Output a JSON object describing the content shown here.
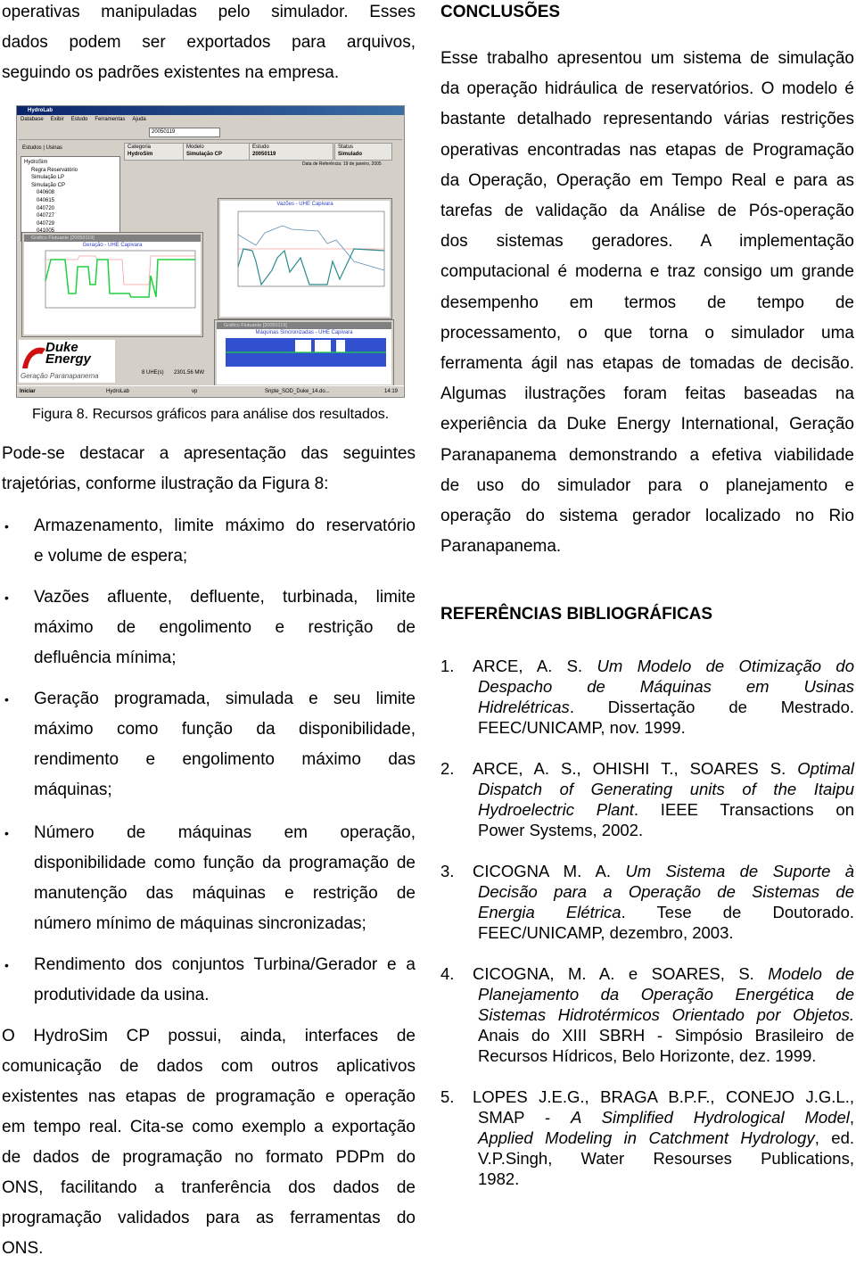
{
  "left": {
    "p1": [
      "operativas manipuladas pelo simulador. Esses",
      "dados podem ser exportados para arquivos,",
      "seguindo os padrões existentes na empresa."
    ],
    "caption": "Figura 8. Recursos gráficos para análise dos resultados.",
    "p2": [
      "Pode-se destacar a apresentação das seguintes",
      "trajetórias, conforme ilustração da Figura 8:"
    ],
    "bullet_symbol": "•",
    "bullets": [
      [
        "Armazenamento, limite máximo do reservatório",
        "e volume de espera;"
      ],
      [
        "Vazões afluente, defluente, turbinada, limite",
        "máximo de engolimento e restrição de",
        "defluência mínima;"
      ],
      [
        "Geração programada, simulada e seu limite",
        "máximo como função da disponibilidade,",
        "rendimento e engolimento máximo das",
        "máquinas;"
      ],
      [
        "Número de máquinas em operação,",
        "disponibilidade como função da programação de",
        "manutenção das máquinas e restrição de",
        "número mínimo de máquinas sincronizadas;"
      ],
      [
        "Rendimento dos conjuntos Turbina/Gerador e a",
        "produtividade da usina."
      ]
    ],
    "p3": [
      "O HydroSim CP possui, ainda, interfaces de",
      "comunicação de dados com outros aplicativos",
      "existentes nas etapas de programação e operação",
      "em tempo real. Cita-se como exemplo a exportação",
      "de dados de programação no formato PDPm do",
      "ONS, facilitando a tranferência dos dados de",
      "programação validados para as ferramentas do",
      "ONS."
    ]
  },
  "figure": {
    "window_title": "HydroLab",
    "menu": [
      "Database",
      "Exibir",
      "Estudo",
      "Ferramentas",
      "Ajuda"
    ],
    "combo_value": "20050119",
    "tabs_left": [
      "Estudos",
      "Usinas"
    ],
    "tree": [
      "HydroSim",
      "Regra Reservatório",
      "Simulação LP",
      "Simulação CP",
      "040608",
      "040615",
      "040720",
      "040727",
      "040729",
      "041005"
    ],
    "header": [
      {
        "label": "Categoria",
        "value": "HydroSim"
      },
      {
        "label": "Modelo",
        "value": "Simulação CP"
      },
      {
        "label": "Estudo",
        "value": "20050119"
      },
      {
        "label": "Status",
        "value": "Simulado"
      }
    ],
    "ref_date": "Data de Referência: 19 de janeiro, 2005",
    "chart1_title": "Geração - UHE Capivara",
    "chart2_title": "Vazões - UHE Capivara",
    "chart3_title": "Máquinas Sincronizadas - UHE Capivara",
    "float_title": "Gráfico Flutuante [20050119]",
    "logo_line1": "Duke",
    "logo_line2": "Energy",
    "logo_sub": "Geração Paranapanema",
    "status_left": "8 UHE(s)",
    "status_right": "2301.56 MW",
    "taskbar": [
      "Iniciar",
      "HydroLab",
      "vp",
      "Snpte_SOD_Duke_14.do...",
      "14:19"
    ],
    "colors": {
      "green": "#20d040",
      "pink": "#f0a0a0",
      "blue": "#3060c0",
      "teal": "#2a8a8a",
      "bars": "#3050d0"
    }
  },
  "right": {
    "conclusions_heading": "CONCLUSÕES",
    "conclusions": [
      "Esse trabalho apresentou um sistema de simulação",
      "da operação hidráulica de reservatórios. O modelo é",
      "bastante detalhado representando várias restrições",
      "operativas encontradas nas etapas de Programação",
      "da Operação, Operação em Tempo Real e para as",
      "tarefas de validação da Análise de Pós-operação",
      "dos sistemas geradores. A implementação",
      "computacional é moderna e traz consigo um grande",
      "desempenho em termos de tempo de",
      "processamento, o que torna o simulador uma",
      "ferramenta ágil nas etapas de tomadas de decisão.",
      "Algumas ilustrações foram feitas baseadas na",
      "experiência da Duke Energy International, Geração",
      "Paranapanema demonstrando a efetiva viabilidade",
      "de uso do simulador para o planejamento e",
      "operação do sistema gerador localizado no Rio",
      "Paranapanema."
    ],
    "references_heading": "REFERÊNCIAS BIBLIOGRÁFICAS",
    "references": [
      {
        "num": "1.",
        "lines": [
          [
            {
              "t": "ARCE, A. S. "
            },
            {
              "t": "Um Modelo de Otimização do",
              "i": true
            }
          ],
          [
            {
              "t": "Despacho de Máquinas em Usinas",
              "i": true
            }
          ],
          [
            {
              "t": "Hidrelétricas",
              "i": true
            },
            {
              "t": ". Dissertação de Mestrado."
            }
          ],
          [
            {
              "t": "FEEC/UNICAMP, nov. 1999."
            }
          ]
        ]
      },
      {
        "num": "2.",
        "lines": [
          [
            {
              "t": "ARCE, A. S., OHISHI T., SOARES S. "
            },
            {
              "t": "Optimal",
              "i": true
            }
          ],
          [
            {
              "t": "Dispatch of Generating units of the Itaipu",
              "i": true
            }
          ],
          [
            {
              "t": "Hydroelectric Plant",
              "i": true
            },
            {
              "t": ". IEEE Transactions on"
            }
          ],
          [
            {
              "t": "Power Systems, 2002."
            }
          ]
        ]
      },
      {
        "num": "3.",
        "lines": [
          [
            {
              "t": "CICOGNA M. A. "
            },
            {
              "t": "Um Sistema de Suporte à",
              "i": true
            }
          ],
          [
            {
              "t": "Decisão para a Operação de Sistemas de",
              "i": true
            }
          ],
          [
            {
              "t": "Energia Elétrica",
              "i": true
            },
            {
              "t": ". Tese de Doutorado."
            }
          ],
          [
            {
              "t": "FEEC/UNICAMP, dezembro, 2003."
            }
          ]
        ]
      },
      {
        "num": "4.",
        "lines": [
          [
            {
              "t": "CICOGNA, M. A. e SOARES, S. "
            },
            {
              "t": "Modelo de",
              "i": true
            }
          ],
          [
            {
              "t": "Planejamento da Operação Energética de",
              "i": true
            }
          ],
          [
            {
              "t": "Sistemas Hidrotérmicos Orientado por Objetos.",
              "i": true
            }
          ],
          [
            {
              "t": "Anais do XIII SBRH - Simpósio Brasileiro de"
            }
          ],
          [
            {
              "t": "Recursos Hídricos, Belo Horizonte, dez. 1999."
            }
          ]
        ]
      },
      {
        "num": "5.",
        "lines": [
          [
            {
              "t": "LOPES J.E.G., BRAGA B.P.F., CONEJO J.G.L.,"
            }
          ],
          [
            {
              "t": "SMAP - "
            },
            {
              "t": "A Simplified Hydrological Model",
              "i": true
            },
            {
              "t": ","
            }
          ],
          [
            {
              "t": "Applied Modeling in Catchment Hydrology",
              "i": true
            },
            {
              "t": ", ed."
            }
          ],
          [
            {
              "t": "V.P.Singh, Water Resourses Publications,"
            }
          ],
          [
            {
              "t": "1982."
            }
          ]
        ]
      }
    ]
  }
}
